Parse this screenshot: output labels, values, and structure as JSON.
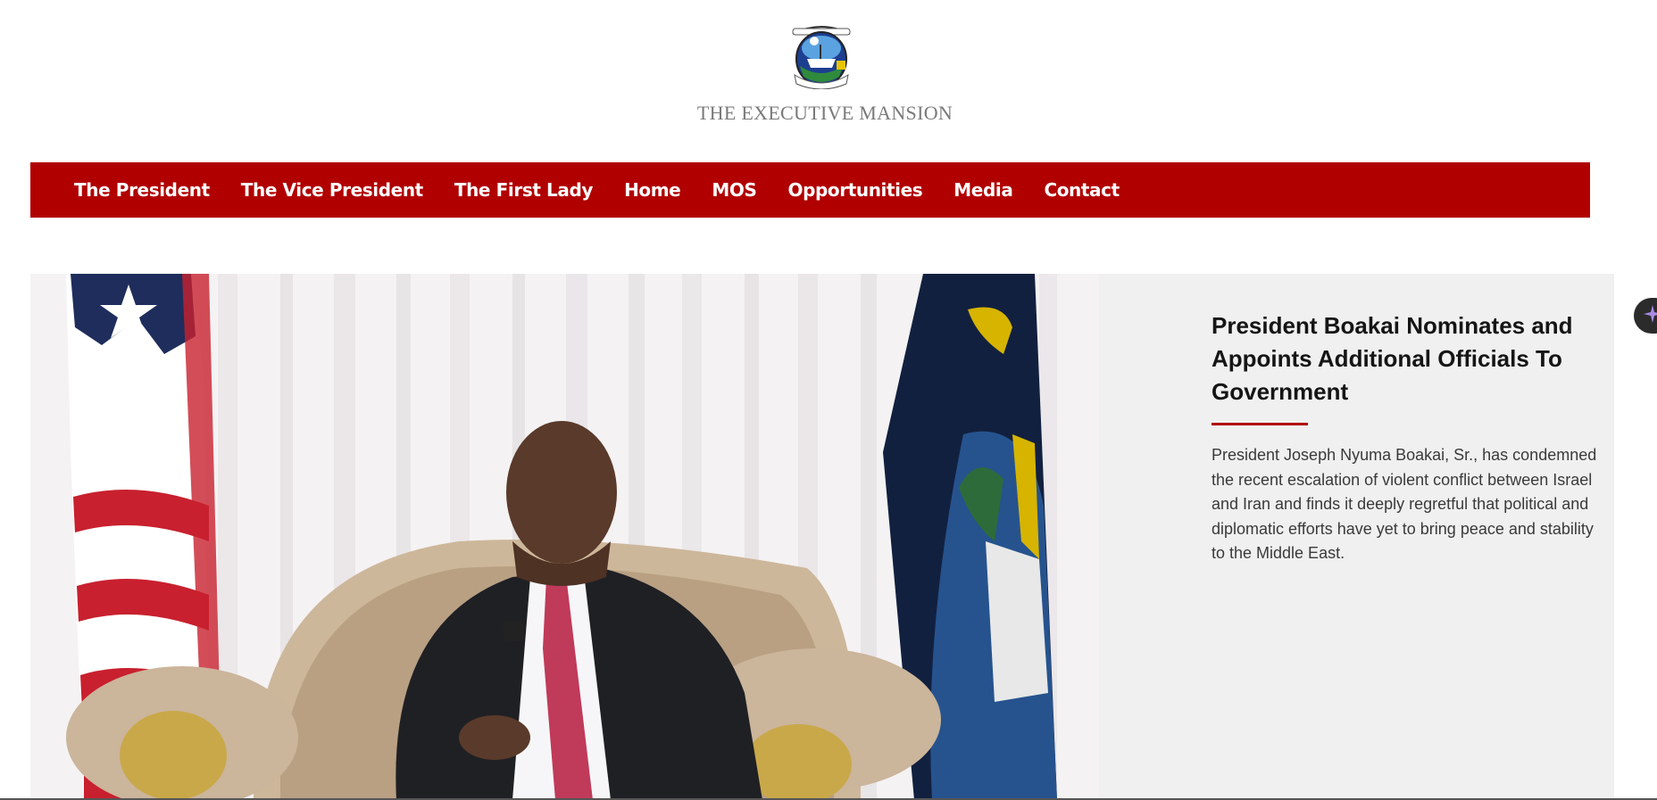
{
  "header": {
    "seal_icon": "liberia-coat-of-arms-icon",
    "title": "THE EXECUTIVE MANSION"
  },
  "nav": {
    "items": [
      {
        "label": "The President"
      },
      {
        "label": "The Vice President"
      },
      {
        "label": "The First Lady"
      },
      {
        "label": "Home"
      },
      {
        "label": "MOS"
      },
      {
        "label": "Opportunities"
      },
      {
        "label": "Media"
      },
      {
        "label": "Contact"
      }
    ]
  },
  "hero": {
    "headline": "President Boakai Nominates and Appoints Additional Officials To Government",
    "summary": "President Joseph Nyuma Boakai, Sr., has condemned the recent escalation of violent conflict between Israel and Iran and finds it deeply regretful that political and diplomatic efforts have yet to bring peace and stability to the Middle East."
  },
  "floating": {
    "icon": "sparkle-icon"
  },
  "colors": {
    "nav_background": "#b10000",
    "accent_underline": "#b10000",
    "hero_panel": "#f0f0f0"
  }
}
